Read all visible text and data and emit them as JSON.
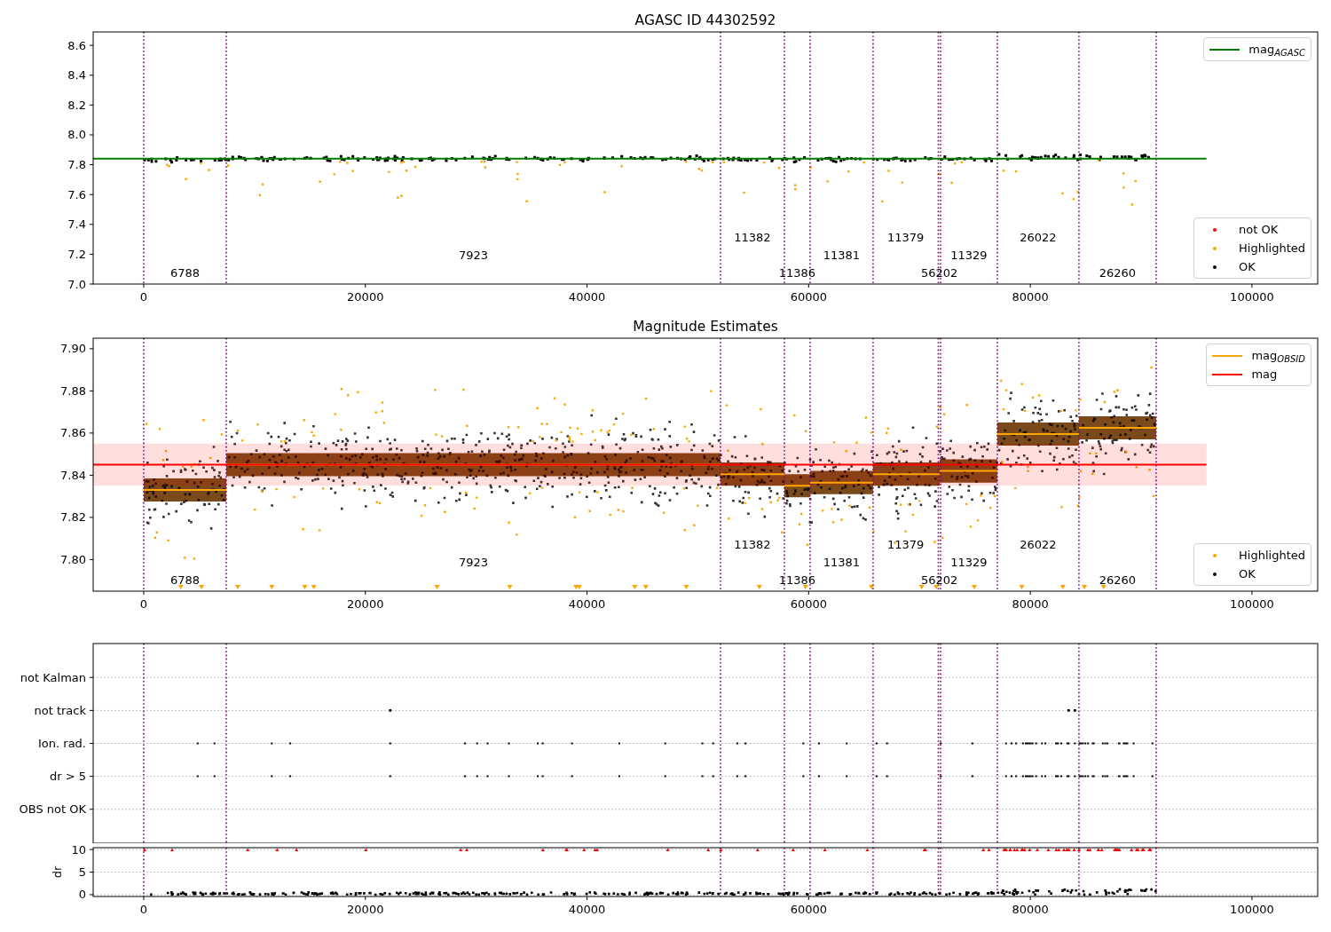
{
  "panels": [
    {
      "kind": "magnitude",
      "markers": [
        {
          "label": "not OK",
          "color": "#ff0000"
        },
        {
          "label": "Highlighted",
          "color": "#ffa500"
        },
        {
          "label": "OK",
          "color": "#000000"
        }
      ],
      "chart_data": {
        "type": "line",
        "title": "AGASC ID 44302592",
        "legend": "upper right",
        "xlim": [
          -4560,
          105930
        ],
        "ylim": [
          7.0,
          8.69
        ],
        "xticks": [
          0,
          20000,
          40000,
          60000,
          80000,
          100000
        ],
        "yticks": [
          {
            "value": 7.0,
            "label": "7.0"
          },
          {
            "value": 7.2,
            "label": "7.2"
          },
          {
            "value": 7.4,
            "label": "7.4"
          },
          {
            "value": 7.6,
            "label": "7.6"
          },
          {
            "value": 7.8,
            "label": "7.8"
          },
          {
            "value": 8.0,
            "label": "8.0"
          },
          {
            "value": 8.2,
            "label": "8.2"
          },
          {
            "value": 8.4,
            "label": "8.4"
          },
          {
            "value": 8.6,
            "label": "8.6"
          }
        ],
        "series": [
          {
            "name": "mag$_{AGASC}$",
            "color": "#008000",
            "x": [
              -4560,
              95900
            ],
            "values": [
              7.84,
              7.84
            ]
          }
        ],
        "ref_lines": [
          {
            "axis": "x",
            "value": 0
          },
          {
            "axis": "x",
            "value": 7446
          },
          {
            "axis": "x",
            "value": 52042
          },
          {
            "axis": "x",
            "value": 57806
          },
          {
            "axis": "x",
            "value": 60128
          },
          {
            "axis": "x",
            "value": 65813
          },
          {
            "axis": "x",
            "value": 71700
          },
          {
            "axis": "x",
            "value": 71900
          },
          {
            "axis": "x",
            "value": 77022
          },
          {
            "axis": "x",
            "value": 84387
          },
          {
            "axis": "x",
            "value": 91353
          }
        ],
        "annotations": [
          "6788",
          "7923",
          "11382",
          "11386",
          "11381",
          "11379",
          "56202",
          "11329",
          "26022",
          "26260"
        ]
      }
    },
    {
      "kind": "estimates",
      "markers": [
        {
          "label": "Highlighted",
          "color": "#ffa500"
        },
        {
          "label": "OK",
          "color": "#000000"
        }
      ],
      "chart_data": {
        "type": "line",
        "title": "Magnitude Estimates",
        "legend": "upper right",
        "xlim": [
          -4560,
          105930
        ],
        "ylim": [
          7.785,
          7.905
        ],
        "xticks": [
          0,
          20000,
          40000,
          60000,
          80000,
          100000
        ],
        "yticks": [
          {
            "value": 7.8,
            "label": "7.80"
          },
          {
            "value": 7.82,
            "label": "7.82"
          },
          {
            "value": 7.84,
            "label": "7.84"
          },
          {
            "value": 7.86,
            "label": "7.86"
          },
          {
            "value": 7.88,
            "label": "7.88"
          },
          {
            "value": 7.9,
            "label": "7.90"
          }
        ],
        "series": [
          {
            "name": "mag$_{OBSID}$",
            "color": "#ffa500",
            "x": [
              0,
              7446,
              7446,
              52042,
              52042,
              57806,
              57806,
              60128,
              60128,
              65813,
              65813,
              71817,
              71817,
              77022,
              77022,
              84387,
              84387,
              91353
            ],
            "values": [
              7.833,
              7.833,
              7.845,
              7.845,
              7.8405,
              7.8405,
              7.835,
              7.835,
              7.8365,
              7.8365,
              7.8405,
              7.8405,
              7.842,
              7.842,
              7.8595,
              7.8595,
              7.8625,
              7.8625
            ]
          },
          {
            "name": "mag",
            "color": "#ff0000",
            "x": [
              -4560,
              95900
            ],
            "values": [
              7.845,
              7.845
            ]
          }
        ],
        "bands": [
          {
            "axis": "y",
            "from": 7.835,
            "to": 7.855
          }
        ],
        "ref_lines": [
          {
            "axis": "x",
            "value": 0
          },
          {
            "axis": "x",
            "value": 7446
          },
          {
            "axis": "x",
            "value": 52042
          },
          {
            "axis": "x",
            "value": 57806
          },
          {
            "axis": "x",
            "value": 60128
          },
          {
            "axis": "x",
            "value": 65813
          },
          {
            "axis": "x",
            "value": 71700
          },
          {
            "axis": "x",
            "value": 71900
          },
          {
            "axis": "x",
            "value": 77022
          },
          {
            "axis": "x",
            "value": 84387
          },
          {
            "axis": "x",
            "value": 91353
          }
        ],
        "annotations": [
          "6788",
          "7923",
          "11382",
          "11386",
          "11381",
          "11379",
          "56202",
          "11329",
          "26022",
          "26260"
        ]
      }
    },
    {
      "kind": "flags",
      "rows": [
        "not Kalman",
        "not track",
        "Ion. rad.",
        "dr > 5",
        "OBS not OK"
      ]
    },
    {
      "kind": "dr",
      "chart_data": {
        "type": "scatter",
        "ylabel": "dr",
        "xlim": [
          -4560,
          105930
        ],
        "ylim": [
          -0.4,
          10.4
        ],
        "xticks": [
          0,
          20000,
          40000,
          60000,
          80000,
          100000
        ],
        "yticks": [
          0,
          5,
          10
        ],
        "ref_lines": [
          {
            "axis": "x",
            "value": 0
          },
          {
            "axis": "x",
            "value": 7446
          },
          {
            "axis": "x",
            "value": 52042
          },
          {
            "axis": "x",
            "value": 57806
          },
          {
            "axis": "x",
            "value": 60128
          },
          {
            "axis": "x",
            "value": 65813
          },
          {
            "axis": "x",
            "value": 71700
          },
          {
            "axis": "x",
            "value": 71900
          },
          {
            "axis": "x",
            "value": 77022
          },
          {
            "axis": "x",
            "value": 84387
          },
          {
            "axis": "x",
            "value": 91353
          }
        ]
      }
    }
  ]
}
